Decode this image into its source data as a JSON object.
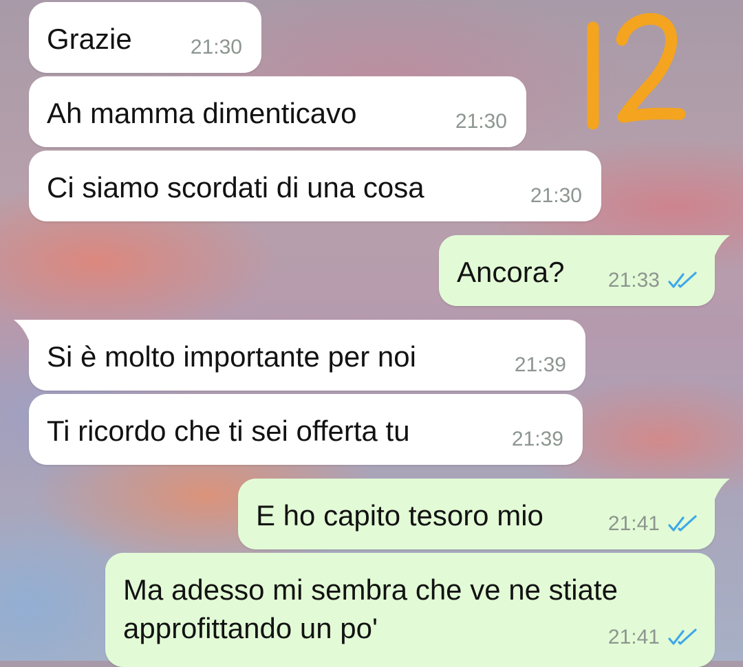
{
  "annotation": {
    "text": "12",
    "color": "#f4a41e"
  },
  "colors": {
    "incoming": "#ffffff",
    "outgoing": "#e2fbd6",
    "time": "#8c958f",
    "ticks": "#3ea8e8"
  },
  "messages": [
    {
      "direction": "incoming",
      "text": "Grazie",
      "time": "21:30"
    },
    {
      "direction": "incoming",
      "text": "Ah mamma dimenticavo",
      "time": "21:30"
    },
    {
      "direction": "incoming",
      "text": "Ci siamo scordati di una cosa",
      "time": "21:30"
    },
    {
      "direction": "outgoing",
      "text": "Ancora?",
      "time": "21:33",
      "status": "read"
    },
    {
      "direction": "incoming",
      "text": "Si è molto importante per noi",
      "time": "21:39"
    },
    {
      "direction": "incoming",
      "text": "Ti ricordo che ti sei offerta tu",
      "time": "21:39"
    },
    {
      "direction": "outgoing",
      "text": "E ho capito tesoro mio",
      "time": "21:41",
      "status": "read"
    },
    {
      "direction": "outgoing",
      "text": "Ma adesso mi sembra che ve ne stiate\napprofittando un po'",
      "time": "21:41",
      "status": "read"
    }
  ]
}
